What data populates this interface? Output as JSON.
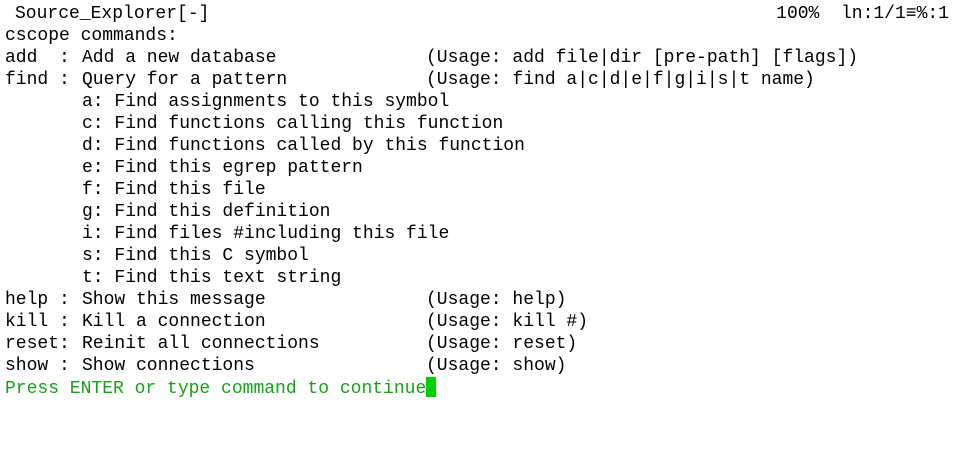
{
  "statusline": {
    "title": "Source_Explorer[-]",
    "percent": "100%",
    "position": "ln:1/1≡%:1"
  },
  "header": "cscope commands:",
  "commands": {
    "add": {
      "name": "add  :",
      "desc": "Add a new database",
      "usage": "(Usage: add file|dir [pre-path] [flags])"
    },
    "find": {
      "name": "find :",
      "desc": "Query for a pattern",
      "usage": "(Usage: find a|c|d|e|f|g|i|s|t name)",
      "options": [
        "a: Find assignments to this symbol",
        "c: Find functions calling this function",
        "d: Find functions called by this function",
        "e: Find this egrep pattern",
        "f: Find this file",
        "g: Find this definition",
        "i: Find files #including this file",
        "s: Find this C symbol",
        "t: Find this text string"
      ]
    },
    "help": {
      "name": "help :",
      "desc": "Show this message",
      "usage": "(Usage: help)"
    },
    "kill": {
      "name": "kill :",
      "desc": "Kill a connection",
      "usage": "(Usage: kill #)"
    },
    "reset": {
      "name": "reset:",
      "desc": "Reinit all connections",
      "usage": "(Usage: reset)"
    },
    "show": {
      "name": "show :",
      "desc": "Show connections",
      "usage": "(Usage: show)"
    }
  },
  "prompt": "Press ENTER or type command to continue",
  "colors": {
    "prompt": "#19a119",
    "cursor": "#00d000",
    "text": "#000000",
    "background": "#ffffff"
  }
}
